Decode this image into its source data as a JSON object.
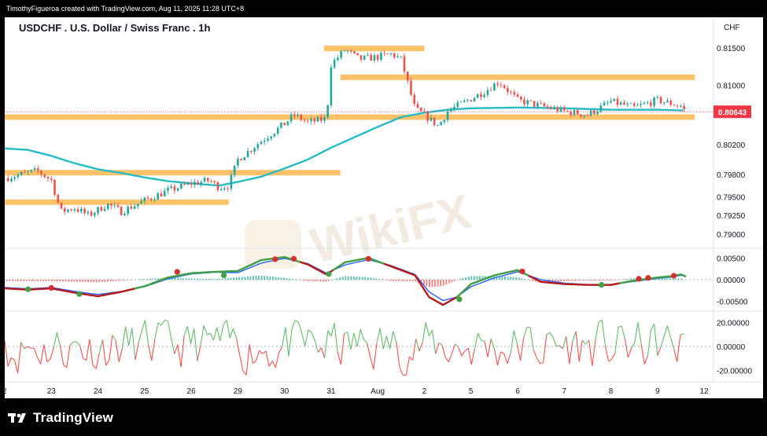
{
  "header": {
    "attribution": "TimothyFigueroa created with TradingView.com, Aug 11, 2025 11:28 UTC+8"
  },
  "footer": {
    "brand": "TradingView"
  },
  "watermark": {
    "text": "WikiFX"
  },
  "colors": {
    "candle_up": "#26a69a",
    "candle_down": "#ef5350",
    "moving_average": "#26bcc6",
    "zones": "#ffb74d",
    "last_price": "#f23645",
    "macd_fast": "#43a047",
    "macd_slow": "#2962ff",
    "macd_red": "#b71c1c"
  },
  "chart_data": [
    {
      "type": "candlestick",
      "title": "USDCHF . U.S. Dollar / Swiss Franc . 1h",
      "currency": "CHF",
      "ylim": [
        0.7885,
        0.8185
      ],
      "y_ticks": [
        "0.81500",
        "0.81000",
        "0.80200",
        "0.79800",
        "0.79500",
        "0.79250",
        "0.79000"
      ],
      "last_price": "0.80643",
      "x_ticks": [
        "2",
        "23",
        "24",
        "25",
        "26",
        "29",
        "30",
        "31",
        "Aug",
        "2",
        "5",
        "6",
        "7",
        "8",
        "9",
        "12"
      ],
      "close_path": [
        [
          0,
          0.7975
        ],
        [
          0.7,
          0.7985
        ],
        [
          1.0,
          0.7972
        ],
        [
          1.2,
          0.793
        ],
        [
          1.5,
          0.7935
        ],
        [
          1.8,
          0.7925
        ],
        [
          2.2,
          0.794
        ],
        [
          2.5,
          0.793
        ],
        [
          3.0,
          0.7945
        ],
        [
          3.5,
          0.7958
        ],
        [
          4.0,
          0.7968
        ],
        [
          4.4,
          0.7972
        ],
        [
          4.6,
          0.7962
        ],
        [
          4.8,
          0.7965
        ],
        [
          5.0,
          0.8
        ],
        [
          5.5,
          0.8025
        ],
        [
          6.0,
          0.8048
        ],
        [
          6.2,
          0.806
        ],
        [
          6.5,
          0.805
        ],
        [
          6.9,
          0.8055
        ],
        [
          7.0,
          0.8128
        ],
        [
          7.3,
          0.8148
        ],
        [
          7.6,
          0.8135
        ],
        [
          8.0,
          0.8138
        ],
        [
          8.3,
          0.8142
        ],
        [
          8.5,
          0.8135
        ],
        [
          8.8,
          0.8068
        ],
        [
          9.0,
          0.806
        ],
        [
          9.3,
          0.8045
        ],
        [
          9.5,
          0.8065
        ],
        [
          10.0,
          0.8082
        ],
        [
          10.3,
          0.8092
        ],
        [
          10.6,
          0.8105
        ],
        [
          11.0,
          0.808
        ],
        [
          11.5,
          0.8072
        ],
        [
          12.0,
          0.8065
        ],
        [
          12.5,
          0.806
        ],
        [
          13.0,
          0.8078
        ],
        [
          13.5,
          0.807
        ],
        [
          14.0,
          0.808
        ],
        [
          14.5,
          0.8072
        ],
        [
          14.6,
          0.80643
        ]
      ],
      "zones": [
        {
          "from": 6.85,
          "to": 9.0,
          "price": 0.81494
        },
        {
          "from": 7.2,
          "to": 14.8,
          "price": 0.81107
        },
        {
          "from": 0,
          "to": 14.8,
          "price": 0.80571
        },
        {
          "from": 0,
          "to": 7.2,
          "price": 0.79824
        },
        {
          "from": 0,
          "to": 4.8,
          "price": 0.79428
        }
      ],
      "moving_average_path": [
        [
          0,
          0.8015
        ],
        [
          0.5,
          0.8013
        ],
        [
          1.0,
          0.8005
        ],
        [
          1.5,
          0.7995
        ],
        [
          2.0,
          0.7987
        ],
        [
          2.5,
          0.7982
        ],
        [
          3.0,
          0.7976
        ],
        [
          3.5,
          0.7971
        ],
        [
          4.0,
          0.7968
        ],
        [
          4.6,
          0.7965
        ],
        [
          5.0,
          0.797
        ],
        [
          5.5,
          0.7977
        ],
        [
          6.0,
          0.7988
        ],
        [
          6.5,
          0.8
        ],
        [
          7.0,
          0.8016
        ],
        [
          7.5,
          0.803
        ],
        [
          8.0,
          0.8044
        ],
        [
          8.5,
          0.8057
        ],
        [
          9.0,
          0.8063
        ],
        [
          9.5,
          0.8067
        ],
        [
          10.0,
          0.8069
        ],
        [
          11.0,
          0.807
        ],
        [
          12.0,
          0.8069
        ],
        [
          13.0,
          0.8067
        ],
        [
          14.0,
          0.8067
        ],
        [
          14.6,
          0.8066
        ]
      ]
    },
    {
      "type": "line",
      "name": "oscillator-1",
      "ylim": [
        -0.0065,
        0.0065
      ],
      "y_ticks": [
        "0.00500",
        "0.00000",
        "-0.00500"
      ],
      "fast_path": [
        [
          0,
          -0.002
        ],
        [
          0.5,
          -0.0023
        ],
        [
          1.0,
          -0.002
        ],
        [
          1.5,
          -0.003
        ],
        [
          2.0,
          -0.0038
        ],
        [
          2.5,
          -0.0028
        ],
        [
          3.0,
          -0.0015
        ],
        [
          3.5,
          0.0005
        ],
        [
          4.0,
          0.0015
        ],
        [
          4.5,
          0.0018
        ],
        [
          5.0,
          0.002
        ],
        [
          5.5,
          0.0045
        ],
        [
          6.0,
          0.0052
        ],
        [
          6.5,
          0.0035
        ],
        [
          6.9,
          0.0012
        ],
        [
          7.3,
          0.004
        ],
        [
          7.8,
          0.005
        ],
        [
          8.3,
          0.003
        ],
        [
          8.8,
          0.001
        ],
        [
          9.1,
          -0.004
        ],
        [
          9.4,
          -0.0058
        ],
        [
          9.7,
          -0.004
        ],
        [
          10.0,
          -0.001
        ],
        [
          10.5,
          0.001
        ],
        [
          11.0,
          0.0022
        ],
        [
          11.5,
          -0.0005
        ],
        [
          12.0,
          -0.001
        ],
        [
          12.5,
          -0.0012
        ],
        [
          13.0,
          -0.0012
        ],
        [
          13.5,
          -0.0002
        ],
        [
          14.0,
          0.0005
        ],
        [
          14.3,
          0.0008
        ],
        [
          14.5,
          0.0012
        ],
        [
          14.6,
          0.0008
        ]
      ],
      "slow_path": [
        [
          0,
          -0.0018
        ],
        [
          0.5,
          -0.0021
        ],
        [
          1.0,
          -0.0018
        ],
        [
          1.5,
          -0.0027
        ],
        [
          2.0,
          -0.0034
        ],
        [
          2.5,
          -0.0027
        ],
        [
          3.0,
          -0.0016
        ],
        [
          3.5,
          0.0002
        ],
        [
          4.0,
          0.0013
        ],
        [
          4.5,
          0.0017
        ],
        [
          5.0,
          0.0016
        ],
        [
          5.5,
          0.0038
        ],
        [
          6.0,
          0.0049
        ],
        [
          6.5,
          0.0037
        ],
        [
          6.9,
          0.0015
        ],
        [
          7.3,
          0.0034
        ],
        [
          7.8,
          0.0046
        ],
        [
          8.3,
          0.0032
        ],
        [
          8.8,
          0.0012
        ],
        [
          9.1,
          -0.0028
        ],
        [
          9.4,
          -0.0048
        ],
        [
          9.7,
          -0.004
        ],
        [
          10.0,
          -0.0016
        ],
        [
          10.5,
          0.0004
        ],
        [
          11.0,
          0.0018
        ],
        [
          11.5,
          0.0
        ],
        [
          12.0,
          -0.0008
        ],
        [
          12.5,
          -0.0011
        ],
        [
          13.0,
          -0.0011
        ],
        [
          13.5,
          -0.0004
        ],
        [
          14.0,
          0.0003
        ],
        [
          14.3,
          0.0006
        ],
        [
          14.5,
          0.001
        ],
        [
          14.6,
          0.0009
        ]
      ],
      "signal_dots": [
        {
          "x": 0.5,
          "y": -0.0022,
          "color": "green"
        },
        {
          "x": 1.0,
          "y": -0.0019,
          "color": "red"
        },
        {
          "x": 1.6,
          "y": -0.0033,
          "color": "green"
        },
        {
          "x": 3.7,
          "y": 0.0018,
          "color": "red"
        },
        {
          "x": 4.7,
          "y": 0.001,
          "color": "green"
        },
        {
          "x": 5.8,
          "y": 0.0047,
          "color": "red"
        },
        {
          "x": 6.2,
          "y": 0.0048,
          "color": "red"
        },
        {
          "x": 6.95,
          "y": 0.0013,
          "color": "green"
        },
        {
          "x": 7.8,
          "y": 0.0048,
          "color": "red"
        },
        {
          "x": 9.75,
          "y": -0.0045,
          "color": "green"
        },
        {
          "x": 11.1,
          "y": 0.0019,
          "color": "red"
        },
        {
          "x": 12.8,
          "y": -0.0012,
          "color": "green"
        },
        {
          "x": 13.6,
          "y": 0.0002,
          "color": "red"
        },
        {
          "x": 13.8,
          "y": 0.0004,
          "color": "red"
        },
        {
          "x": 14.35,
          "y": 0.0009,
          "color": "red"
        }
      ]
    },
    {
      "type": "line",
      "name": "oscillator-2",
      "ylim": [
        -27,
        27
      ],
      "y_ticks": [
        "20.00000",
        "0.00000",
        "-20.00000"
      ],
      "seed": 11
    }
  ]
}
